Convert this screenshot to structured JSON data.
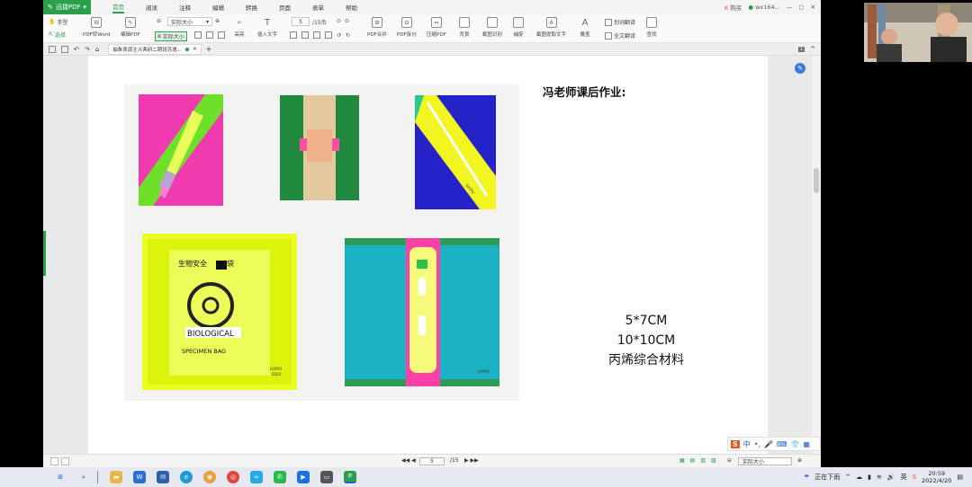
{
  "app": {
    "name": "迅捷PDF",
    "menus": [
      "首页",
      "阅读",
      "注释",
      "编辑",
      "转换",
      "页面",
      "表单",
      "帮助"
    ],
    "right": {
      "label1": "购买",
      "user": "wx164..."
    }
  },
  "toolbar": {
    "hand": "手型",
    "select": "选择",
    "pdf_to_word": "PDF转Word",
    "edit_pdf": "编辑PDF",
    "zoom_value": "实际大小",
    "actual_size": "实际大小",
    "highlight": "高亮",
    "insert_text": "插入文字",
    "page_current": "5",
    "page_total": "/15页",
    "merge": "PDF合并",
    "split": "PDF拆分",
    "compress": "压缩PDF",
    "background": "背景",
    "screenshot_ocr": "截图识别",
    "capture": "捕捉",
    "screenshot_text": "截图提取文字",
    "cover": "覆盖",
    "translate": "划词翻译",
    "full_translate": "全文翻译",
    "find": "查找"
  },
  "tabs": {
    "doc_title": "抽象表现主义弗研二期班苏逸..."
  },
  "document": {
    "caption_title": "冯老师课后作业:",
    "caption_lines": [
      "5*7CM",
      "10*10CM",
      "丙烯综合材料"
    ],
    "photo": {
      "bag_cn": "生物安全",
      "bag_cn2": "袋",
      "bag_label": "BIOLOGICAL",
      "bag_sub": "SPECIMEN BAG",
      "sign": "LUOYU",
      "year": "2022."
    }
  },
  "statusbar": {
    "page_current": "5",
    "page_total": "/15",
    "zoom": "实际大小"
  },
  "taskbar": {
    "weather": "正在下雨",
    "time": "20:59",
    "date": "2022/4/20"
  },
  "colors": {
    "accent": "#2b9f4b",
    "taskbar": "#e6e9ef"
  }
}
